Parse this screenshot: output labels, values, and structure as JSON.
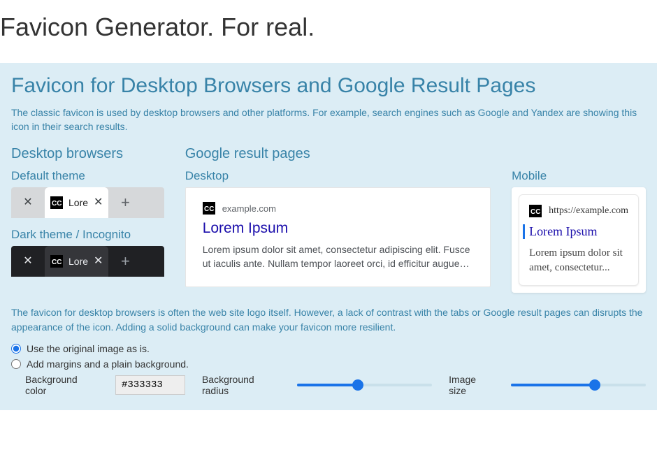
{
  "page": {
    "title": "Favicon Generator. For real."
  },
  "panel": {
    "heading": "Favicon for Desktop Browsers and Google Result Pages",
    "description": "The classic favicon is used by desktop browsers and other platforms. For example, search engines such as Google and Yandex are showing this icon in their search results."
  },
  "labels": {
    "desktop_browsers": "Desktop browsers",
    "google_result_pages": "Google result pages",
    "default_theme": "Default theme",
    "dark_theme": "Dark theme / Incognito",
    "desktop": "Desktop",
    "mobile": "Mobile"
  },
  "tab": {
    "title": "Lore"
  },
  "google_desktop": {
    "url": "example.com",
    "title": "Lorem Ipsum",
    "desc": "Lorem ipsum dolor sit amet, consectetur adipiscing elit. Fusce ut iaculis ante. Nullam tempor laoreet orci, id efficitur augue…"
  },
  "google_mobile": {
    "url": "https://example.com",
    "title": "Lorem Ipsum",
    "desc": "Lorem ipsum dolor sit amet, consectetur..."
  },
  "help": "The favicon for desktop browsers is often the web site logo itself. However, a lack of contrast with the tabs or Google result pages can disrupts the appearance of the icon. Adding a solid background can make your favicon more resilient.",
  "options": {
    "use_original": "Use the original image as is.",
    "add_margins": "Add margins and a plain background.",
    "selected": "use_original"
  },
  "controls": {
    "bg_color_label": "Background color",
    "bg_color_value": "#333333",
    "bg_radius_label": "Background radius",
    "bg_radius_pct": 45,
    "image_size_label": "Image size",
    "image_size_pct": 62
  }
}
